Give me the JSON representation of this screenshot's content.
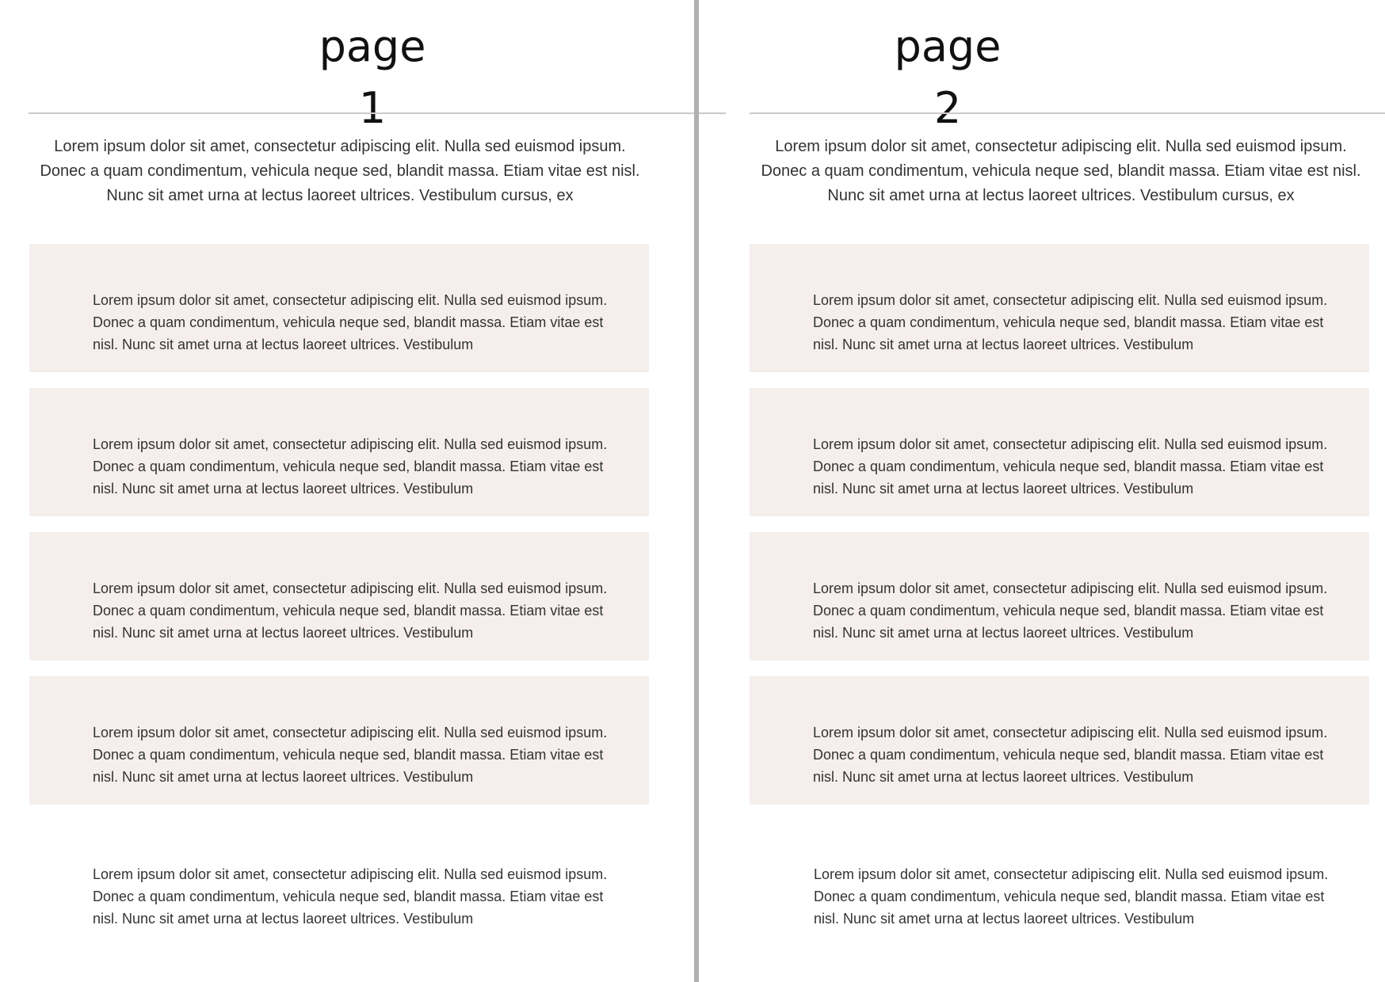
{
  "pages": [
    {
      "title": "page 1",
      "intro": "Lorem ipsum dolor sit amet, consectetur adipiscing elit. Nulla sed euismod ipsum. Donec a quam condimentum, vehicula neque sed, blandit massa. Etiam vitae est nisl. Nunc sit amet urna at lectus laoreet ultrices. Vestibulum cursus, ex",
      "blocks": [
        "Lorem ipsum dolor sit amet, consectetur adipiscing elit. Nulla sed euismod ipsum. Donec a quam condimentum, vehicula neque sed, blandit massa. Etiam vitae est nisl. Nunc sit amet urna at lectus laoreet ultrices. Vestibulum",
        "Lorem ipsum dolor sit amet, consectetur adipiscing elit. Nulla sed euismod ipsum. Donec a quam condimentum, vehicula neque sed, blandit massa. Etiam vitae est nisl. Nunc sit amet urna at lectus laoreet ultrices. Vestibulum",
        "Lorem ipsum dolor sit amet, consectetur adipiscing elit. Nulla sed euismod ipsum. Donec a quam condimentum, vehicula neque sed, blandit massa. Etiam vitae est nisl. Nunc sit amet urna at lectus laoreet ultrices. Vestibulum",
        "Lorem ipsum dolor sit amet, consectetur adipiscing elit. Nulla sed euismod ipsum. Donec a quam condimentum, vehicula neque sed, blandit massa. Etiam vitae est nisl. Nunc sit amet urna at lectus laoreet ultrices. Vestibulum"
      ],
      "closing": "Lorem ipsum dolor sit amet, consectetur adipiscing elit. Nulla sed euismod ipsum. Donec a quam condimentum, vehicula neque sed, blandit massa. Etiam vitae est nisl. Nunc sit amet urna at lectus laoreet ultrices. Vestibulum"
    },
    {
      "title": "page 2",
      "intro": "Lorem ipsum dolor sit amet, consectetur adipiscing elit. Nulla sed euismod ipsum. Donec a quam condimentum, vehicula neque sed, blandit massa. Etiam vitae est nisl. Nunc sit amet urna at lectus laoreet ultrices. Vestibulum cursus, ex",
      "blocks": [
        "Lorem ipsum dolor sit amet, consectetur adipiscing elit. Nulla sed euismod ipsum. Donec a quam condimentum, vehicula neque sed, blandit massa. Etiam vitae est nisl. Nunc sit amet urna at lectus laoreet ultrices. Vestibulum",
        "Lorem ipsum dolor sit amet, consectetur adipiscing elit. Nulla sed euismod ipsum. Donec a quam condimentum, vehicula neque sed, blandit massa. Etiam vitae est nisl. Nunc sit amet urna at lectus laoreet ultrices. Vestibulum",
        "Lorem ipsum dolor sit amet, consectetur adipiscing elit. Nulla sed euismod ipsum. Donec a quam condimentum, vehicula neque sed, blandit massa. Etiam vitae est nisl. Nunc sit amet urna at lectus laoreet ultrices. Vestibulum",
        "Lorem ipsum dolor sit amet, consectetur adipiscing elit. Nulla sed euismod ipsum. Donec a quam condimentum, vehicula neque sed, blandit massa. Etiam vitae est nisl. Nunc sit amet urna at lectus laoreet ultrices. Vestibulum"
      ],
      "closing": "Lorem ipsum dolor sit amet, consectetur adipiscing elit. Nulla sed euismod ipsum. Donec a quam condimentum, vehicula neque sed, blandit massa. Etiam vitae est nisl. Nunc sit amet urna at lectus laoreet ultrices. Vestibulum"
    }
  ],
  "colors": {
    "block_background": "#f5eeed",
    "divider": "#b0b0b0",
    "rule": "#cfc9c7",
    "text": "#333333"
  }
}
